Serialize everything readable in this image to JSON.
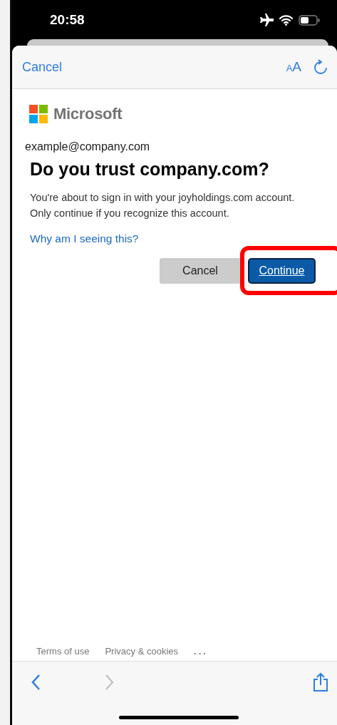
{
  "status_bar": {
    "time": "20:58"
  },
  "sheet_header": {
    "cancel": "Cancel",
    "text_size": "AA"
  },
  "brand": "Microsoft",
  "account": "example@company.com",
  "title": "Do you trust company.com?",
  "message": "You're about to sign in with your joyholdings.com account. Only continue if you recognize this account.",
  "help_link": "Why am I seeing this?",
  "buttons": [
    {
      "label": "Cancel",
      "kind": "secondary",
      "highlighted": false
    },
    {
      "label": "Continue",
      "kind": "primary",
      "highlighted": true
    }
  ],
  "footer_links": [
    "Terms of use",
    "Privacy & cookies",
    "..."
  ],
  "toolbar": {
    "back_enabled": true,
    "forward_enabled": false
  }
}
